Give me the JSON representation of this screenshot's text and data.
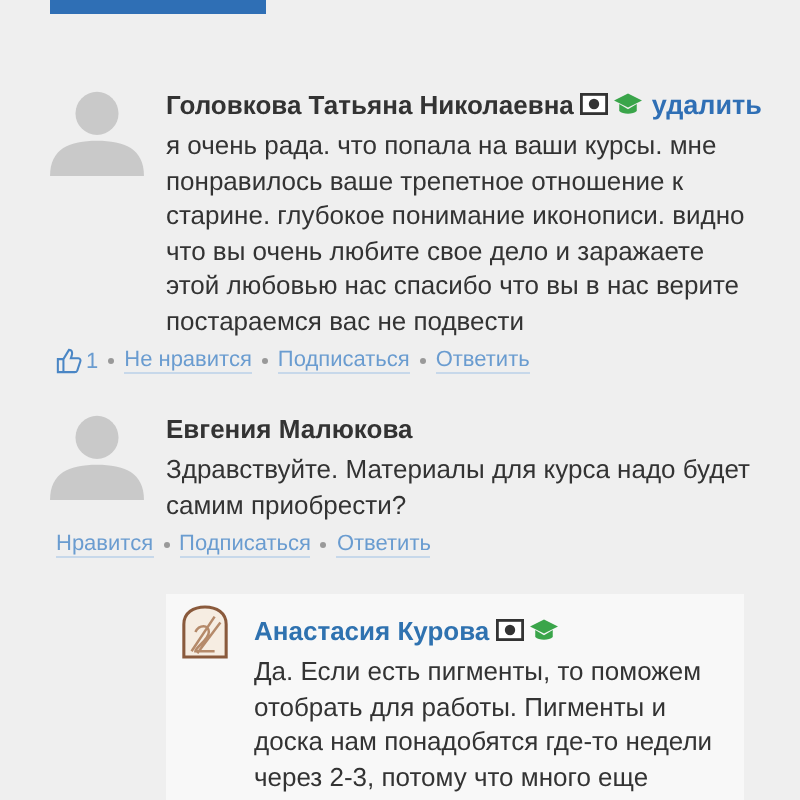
{
  "top_button": {
    "kind": "button"
  },
  "comments": [
    {
      "author": "Головкова Татьяна Николаевна",
      "highlighted": false,
      "certificate": true,
      "graduate": true,
      "delete_link": "удалить",
      "text": "я очень рада. что попала на ваши курсы. мне понравилось ваше трепетное отношение к старине. глубокое понимание иконописи. видно что вы очень любите свое дело и заражаете этой любовью нас спасибо что вы в нас верите постараемся вас не подвести",
      "like_count": "1",
      "actions": [
        "Не нравится",
        "Подписаться",
        "Ответить"
      ]
    },
    {
      "author": "Евгения Малюкова",
      "highlighted": false,
      "text": "Здравствуйте. Материалы для курса надо будет самим приобрести?",
      "actions": [
        "Нравится",
        "Подписаться",
        "Ответить"
      ],
      "replies": [
        {
          "author": "Анастасия Курова",
          "highlighted": true,
          "certificate": true,
          "graduate": true,
          "text": "Да. Если есть пигменты, то поможем отобрать для работы. Пигменты и доска нам понадобятся где-то недели через 2-3, потому что много еще"
        }
      ]
    }
  ]
}
